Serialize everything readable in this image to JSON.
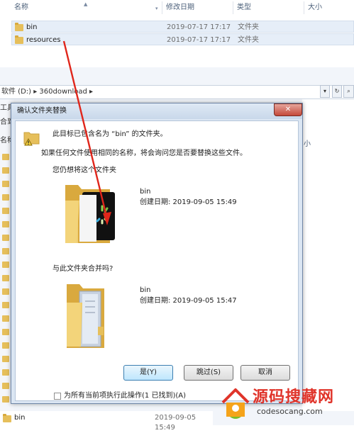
{
  "top_list": {
    "columns": [
      "名称",
      "修改日期",
      "类型",
      "大小"
    ],
    "rows": [
      {
        "name": "bin",
        "date": "2019-07-17 17:17",
        "type": "文件夹"
      },
      {
        "name": "resources",
        "date": "2019-07-17 17:17",
        "type": "文件夹"
      }
    ]
  },
  "explorer2": {
    "address": "软件 (D:)  ▸  360download  ▸",
    "left_labels": [
      "工具",
      "合到",
      "名称"
    ],
    "right_label": "小",
    "bottom_row": {
      "name": "bin",
      "date": "2019-09-05 15:49"
    }
  },
  "dialog": {
    "title": "确认文件夹替换",
    "close": "✕",
    "line1": "此目标已包含名为 “bin” 的文件夹。",
    "line2": "如果任何文件使用相同的名称，将会询问您是否要替换这些文件。",
    "line3": "您仍想将这个文件夹",
    "src": {
      "name": "bin",
      "created": "创建日期: 2019-09-05 15:49"
    },
    "line4": "与此文件夹合并吗?",
    "dst": {
      "name": "bin",
      "created": "创建日期: 2019-09-05 15:47"
    },
    "buttons": {
      "yes": "是(Y)",
      "skip": "跳过(S)",
      "cancel": "取消"
    },
    "checkbox_label": "为所有当前项执行此操作(1 已找到)(A)"
  },
  "watermark": {
    "main": "源码搜藏网",
    "sub": "codesocang.com"
  },
  "colors": {
    "arrow": "#e0261b",
    "folder": "#e6bf5b",
    "accent": "#3c7fb1"
  }
}
